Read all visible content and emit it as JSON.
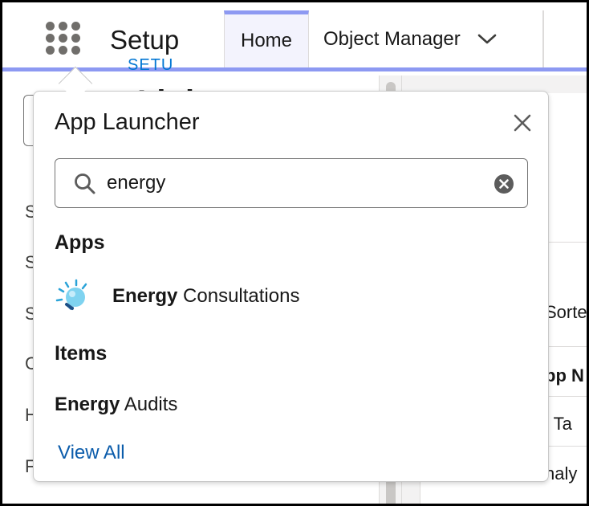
{
  "header": {
    "app_launcher_icon": "waffle-icon",
    "title": "Setup",
    "tabs": [
      {
        "label": "Home",
        "active": true
      },
      {
        "label": "Object Manager",
        "icon": "chevron-down-icon"
      }
    ],
    "accent_color": "#8d99f2"
  },
  "background": {
    "left_letters": [
      "S",
      "S",
      "S",
      "C",
      "H",
      "F"
    ],
    "right_breadcrumb": "SETU",
    "right_title": "Ligh",
    "right_rows": [
      "Sorte",
      "pp N",
      "l Ta",
      "naly"
    ]
  },
  "app_launcher": {
    "title": "App Launcher",
    "close_icon": "close-icon",
    "search": {
      "value": "energy",
      "icon": "search-icon",
      "clear_icon": "clear-icon"
    },
    "apps_heading": "Apps",
    "apps": [
      {
        "match": "Energy",
        "rest": " Consultations",
        "icon": "lightbulb-icon"
      }
    ],
    "items_heading": "Items",
    "items": [
      {
        "match": "Energy",
        "rest": " Audits"
      }
    ],
    "view_all": "View All",
    "link_color": "#0b5cab"
  }
}
